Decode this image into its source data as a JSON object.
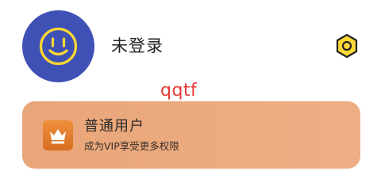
{
  "profile": {
    "username": "未登录",
    "avatar_icon": "smiley-face-icon",
    "avatar_color": "#3f51b5",
    "avatar_face_color": "#fdd835"
  },
  "header": {
    "settings_icon": "hexagon-settings-icon",
    "settings_color": "#fdd835"
  },
  "watermark": {
    "text": "qqtf",
    "color": "#e53935"
  },
  "membership": {
    "title": "普通用户",
    "subtitle": "成为VIP享受更多权限",
    "icon": "crown-icon",
    "card_color": "#eba97f",
    "icon_bg_color": "#e07a2a"
  }
}
